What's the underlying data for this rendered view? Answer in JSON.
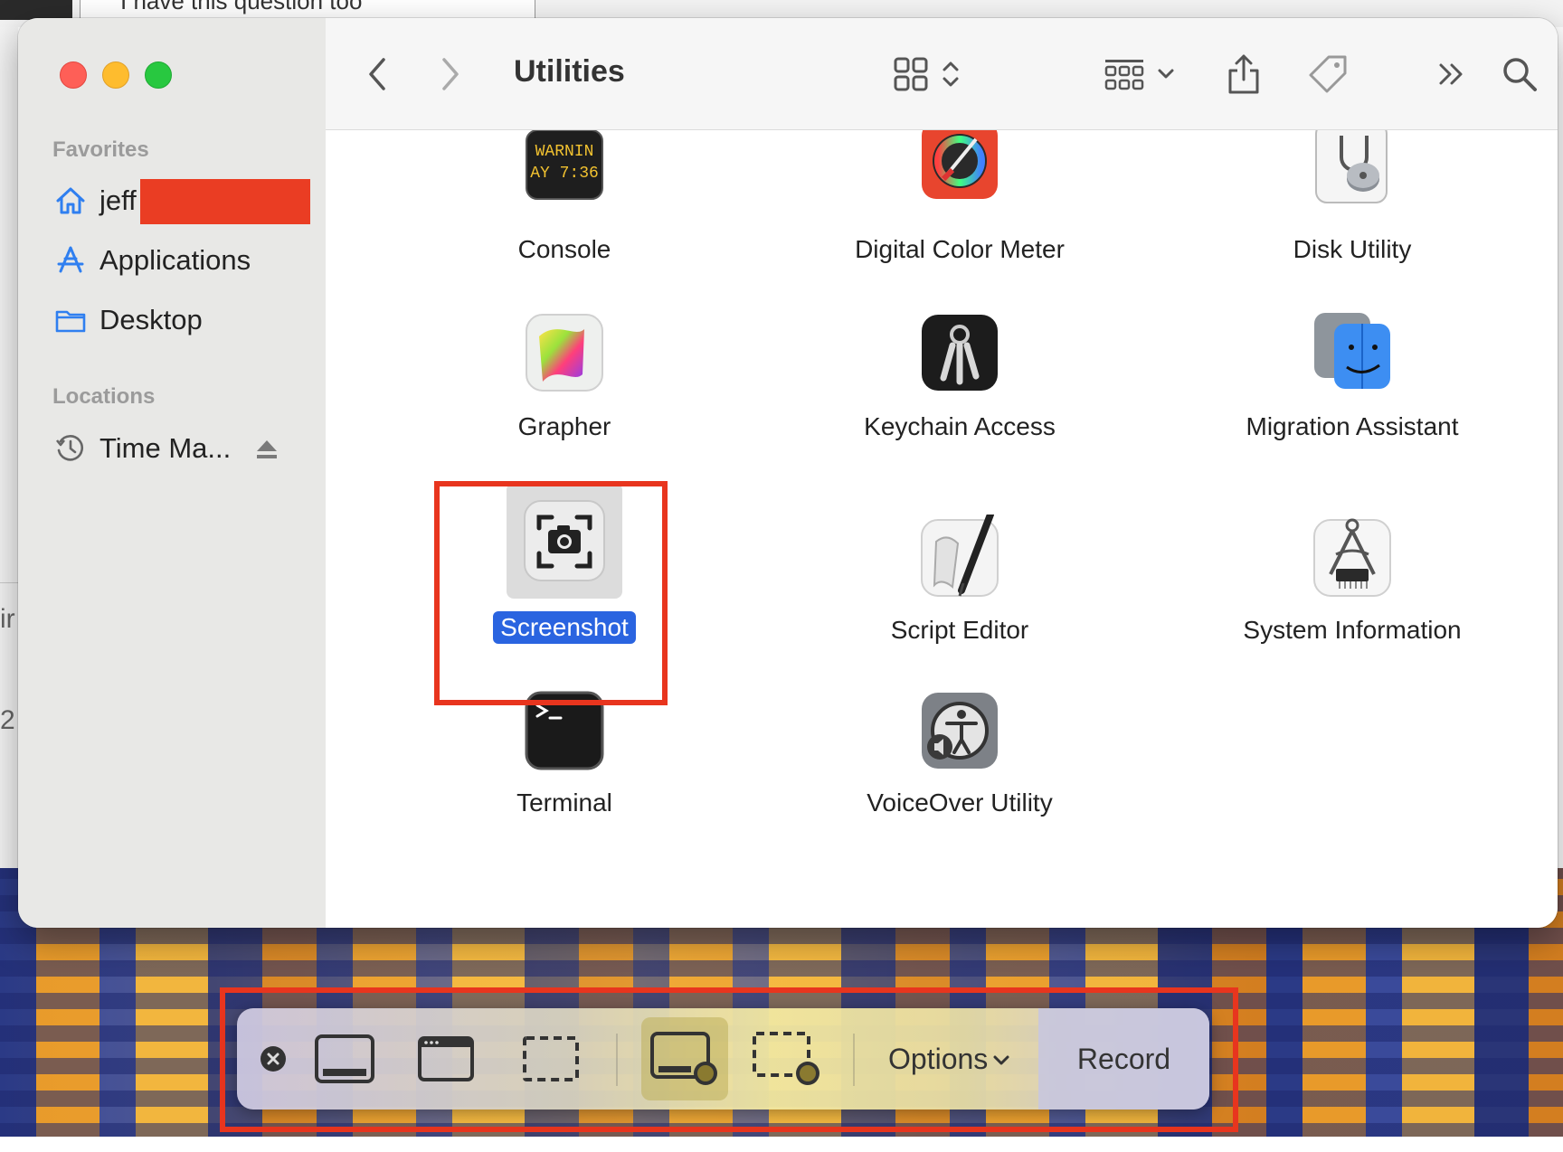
{
  "background": {
    "top_field_text": "I have this question too",
    "left_fragments": [
      "ir",
      "2"
    ]
  },
  "window": {
    "title": "Utilities",
    "sidebar": {
      "favorites_heading": "Favorites",
      "favorites": [
        {
          "label": "jeff",
          "icon": "home-icon"
        },
        {
          "label": "Applications",
          "icon": "applications-icon"
        },
        {
          "label": "Desktop",
          "icon": "folder-icon"
        }
      ],
      "locations_heading": "Locations",
      "locations": [
        {
          "label": "Time Ma...",
          "icon": "time-machine-icon"
        }
      ]
    },
    "apps": [
      {
        "name": "Console",
        "icon_text": "WARNIN\nAY 7:36"
      },
      {
        "name": "Digital Color Meter"
      },
      {
        "name": "Disk Utility"
      },
      {
        "name": "Grapher"
      },
      {
        "name": "Keychain Access"
      },
      {
        "name": "Migration Assistant"
      },
      {
        "name": "Screenshot",
        "selected": true
      },
      {
        "name": "Script Editor"
      },
      {
        "name": "System Information"
      },
      {
        "name": "Terminal"
      },
      {
        "name": "VoiceOver Utility"
      }
    ],
    "colors": {
      "selection": "#2a64e0",
      "annotation": "#e8351e",
      "close": "#fe5f57",
      "minimize": "#febc2e",
      "zoom": "#28c840"
    }
  },
  "capture_bar": {
    "options_label": "Options",
    "record_label": "Record"
  }
}
